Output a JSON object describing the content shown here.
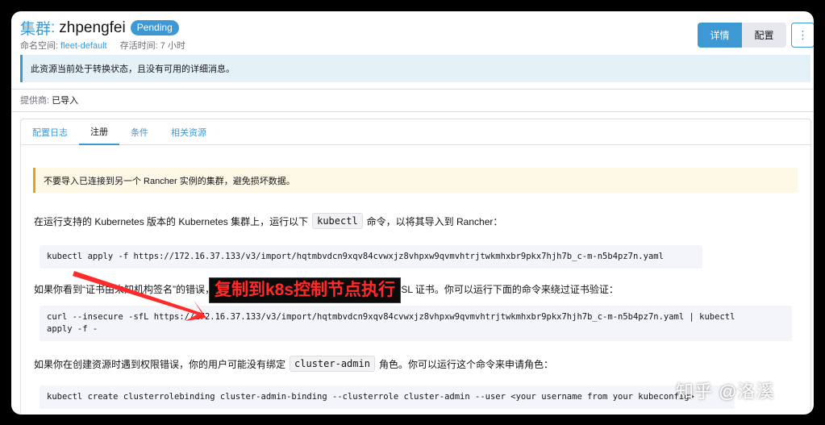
{
  "header": {
    "kind": "集群",
    "colon": ":",
    "name": "zhpengfei",
    "status": "Pending",
    "namespace_label": "命名空间: ",
    "namespace_value": "fleet-default",
    "age_label": "存活时间: 7 小时"
  },
  "actions": {
    "detail": "详情",
    "config": "配置",
    "more": "⋮"
  },
  "info_banner": "此资源当前处于转换状态，且没有可用的详细消息。",
  "provider": {
    "label": "提供商: ",
    "value": "已导入"
  },
  "tabs": [
    "配置日志",
    "注册",
    "条件",
    "相关资源"
  ],
  "active_tab": 1,
  "warning": "不要导入已连接到另一个 Rancher 实例的集群，避免损坏数据。",
  "para1": {
    "before": "在运行支持的 Kubernetes 版本的 Kubernetes 集群上，运行以下",
    "code": "kubectl",
    "after": "命令，以将其导入到 Rancher："
  },
  "cmd1": "kubectl apply -f https://172.16.37.133/v3/import/hqtmbvdcn9xqv84cvwxjz8vhpxw9qvmvhtrjtwkmhxbr9pkx7hjh7b_c-m-n5b4pz7n.yaml",
  "para2": "如果你看到“证书由未知机构签名”的错误，你的 Rancher 安装了自签名或不受信任的 SSL 证书。你可以运行下面的命令来绕过证书验证：",
  "cmd2": "curl --insecure -sfL https://172.16.37.133/v3/import/hqtmbvdcn9xqv84cvwxjz8vhpxw9qvmvhtrjtwkmhxbr9pkx7hjh7b_c-m-n5b4pz7n.yaml | kubectl\napply -f -",
  "para3": {
    "before": "如果你在创建资源时遇到权限错误，你的用户可能没有绑定",
    "code": "cluster-admin",
    "after": "角色。你可以运行这个命令来申请角色："
  },
  "cmd3": "kubectl create clusterrolebinding cluster-admin-binding --clusterrole cluster-admin --user <your username from your kubeconfig>",
  "annotation": "复制到k8s控制节点执行",
  "watermark": "知乎 @洛溪",
  "colors": {
    "accent": "#3d98d3",
    "annotation": "#ff2a2a",
    "warning_border": "#daa520"
  }
}
